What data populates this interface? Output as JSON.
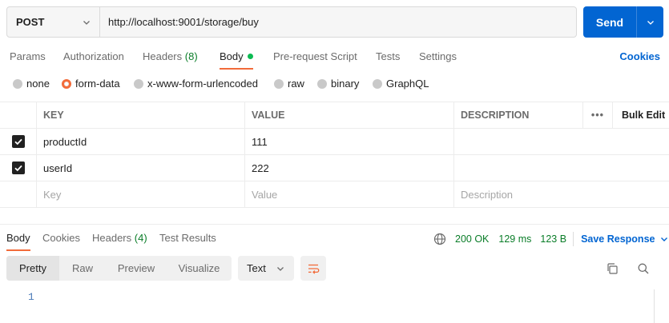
{
  "request": {
    "method": "POST",
    "url": "http://localhost:9001/storage/buy",
    "send_label": "Send"
  },
  "req_tabs": {
    "params": "Params",
    "authorization": "Authorization",
    "headers": "Headers",
    "headers_count": "(8)",
    "body": "Body",
    "pre_request": "Pre-request Script",
    "tests": "Tests",
    "settings": "Settings",
    "cookies": "Cookies"
  },
  "body_types": {
    "none": "none",
    "form_data": "form-data",
    "urlencoded": "x-www-form-urlencoded",
    "raw": "raw",
    "binary": "binary",
    "graphql": "GraphQL",
    "selected": "form-data"
  },
  "table": {
    "headers": {
      "key": "KEY",
      "value": "VALUE",
      "description": "DESCRIPTION",
      "more": "•••",
      "bulk_edit": "Bulk Edit"
    },
    "rows": [
      {
        "key": "productId",
        "value": "111",
        "description": "",
        "checked": true
      },
      {
        "key": "userId",
        "value": "222",
        "description": "",
        "checked": true
      }
    ],
    "placeholders": {
      "key": "Key",
      "value": "Value",
      "description": "Description"
    }
  },
  "response": {
    "tabs": {
      "body": "Body",
      "cookies": "Cookies",
      "headers": "Headers",
      "headers_count": "(4)",
      "test_results": "Test Results"
    },
    "status": "200 OK",
    "time": "129 ms",
    "size": "123 B",
    "save_label": "Save Response",
    "views": {
      "pretty": "Pretty",
      "raw": "Raw",
      "preview": "Preview",
      "visualize": "Visualize"
    },
    "format": "Text",
    "line_number": "1"
  },
  "colors": {
    "accent": "#f26b3a",
    "primary": "#0265d2",
    "success": "#0a7d28"
  }
}
